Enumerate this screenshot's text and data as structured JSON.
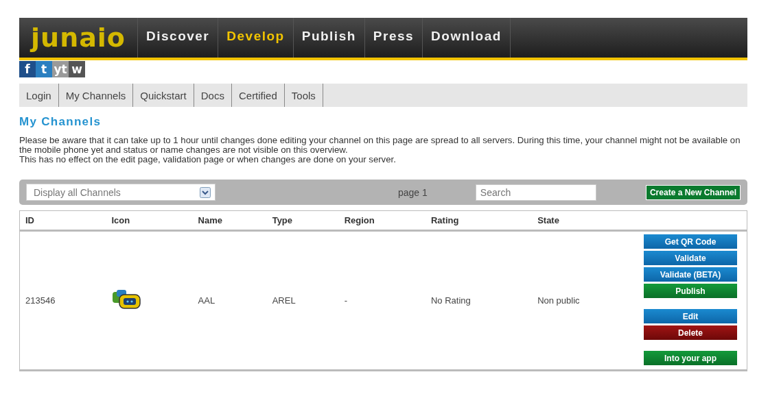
{
  "header": {
    "logo": "junaio",
    "nav": [
      {
        "label": "Discover",
        "selected": false
      },
      {
        "label": "Develop",
        "selected": true
      },
      {
        "label": "Publish",
        "selected": false
      },
      {
        "label": "Press",
        "selected": false
      },
      {
        "label": "Download",
        "selected": false
      }
    ]
  },
  "social": [
    {
      "label": "f",
      "color": "#1f4f8a"
    },
    {
      "label": "t",
      "color": "#2a7fc0"
    },
    {
      "label": "yt",
      "color": "#9a9a9a"
    },
    {
      "label": "w",
      "color": "#555555"
    }
  ],
  "subnav": [
    "Login",
    "My Channels",
    "Quickstart",
    "Docs",
    "Certified",
    "Tools"
  ],
  "heading": "My Channels",
  "notice": [
    "Please be aware that it can take up to 1 hour until changes done editing your channel on this page are spread to all servers. During this time, your channel might not be available on the mobile phone yet and status or name changes are not visible on this overview.",
    "This has no effect on the edit page, validation page or when changes are done on your server."
  ],
  "toolbar": {
    "filter": "Display all Channels",
    "page": "page 1",
    "search": {
      "placeholder": "Search"
    },
    "create": "Create a New Channel"
  },
  "table": {
    "columns": [
      "ID",
      "Icon",
      "Name",
      "Type",
      "Region",
      "Rating",
      "State"
    ],
    "rows": [
      {
        "id": "213546",
        "name": "AAL",
        "type": "AREL",
        "region": "-",
        "rating": "No Rating",
        "state": "Non public",
        "action_groups": [
          [
            {
              "label": "Get QR Code",
              "kind": "blue"
            },
            {
              "label": "Validate",
              "kind": "blue"
            },
            {
              "label": "Validate (BETA)",
              "kind": "blue"
            },
            {
              "label": "Publish",
              "kind": "green"
            }
          ],
          [
            {
              "label": "Edit",
              "kind": "blue"
            },
            {
              "label": "Delete",
              "kind": "red"
            }
          ],
          [
            {
              "label": "Into your app",
              "kind": "green"
            }
          ]
        ]
      }
    ]
  }
}
